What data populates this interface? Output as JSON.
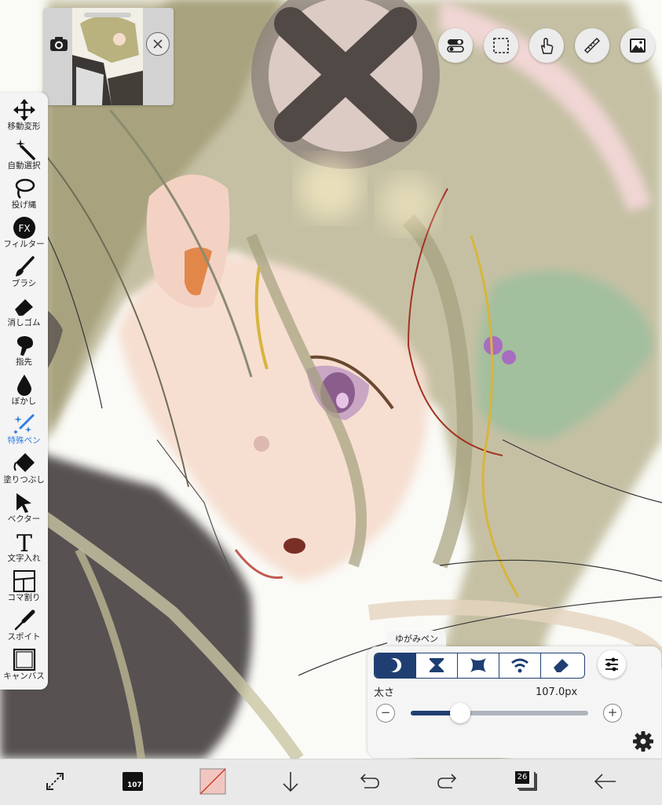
{
  "tools": [
    {
      "label": "移動変形",
      "icon": "move-arrows-icon"
    },
    {
      "label": "自動選択",
      "icon": "magic-wand-icon"
    },
    {
      "label": "投げ縄",
      "icon": "lasso-icon"
    },
    {
      "label": "フィルター",
      "icon": "fx-icon",
      "glyph": "FX"
    },
    {
      "label": "ブラシ",
      "icon": "brush-icon"
    },
    {
      "label": "消しゴム",
      "icon": "eraser-icon"
    },
    {
      "label": "指先",
      "icon": "finger-smudge-icon"
    },
    {
      "label": "ぼかし",
      "icon": "blur-drop-icon"
    },
    {
      "label": "特殊ペン",
      "icon": "special-pen-icon",
      "active": true
    },
    {
      "label": "塗りつぶし",
      "icon": "fill-bucket-icon"
    },
    {
      "label": "ベクター",
      "icon": "vector-cursor-icon"
    },
    {
      "label": "文字入れ",
      "icon": "text-icon",
      "glyph": "T"
    },
    {
      "label": "コマ割り",
      "icon": "frame-divider-icon"
    },
    {
      "label": "スポイト",
      "icon": "eyedropper-icon"
    },
    {
      "label": "キャンバス",
      "icon": "canvas-icon"
    }
  ],
  "top_buttons": [
    "toggle-icon",
    "selection-rect-icon",
    "hand-touch-icon",
    "ruler-icon",
    "image-icon"
  ],
  "brush_panel": {
    "tab_label": "ゆがみペン",
    "modes": [
      "push-mode",
      "pinch-mode",
      "expand-mode",
      "swirl-mode",
      "restore-eraser-mode"
    ],
    "selected_mode": 0,
    "size_label": "太さ",
    "size_value": "107.0px",
    "size_fraction": 0.28,
    "minus": "−",
    "plus": "+"
  },
  "bottom_bar": {
    "brush_size": "107",
    "layer_count": "26"
  },
  "colors": {
    "accent": "#1f3f72",
    "active_tool": "#2f7de1",
    "current_color": "#f2c6c0"
  }
}
